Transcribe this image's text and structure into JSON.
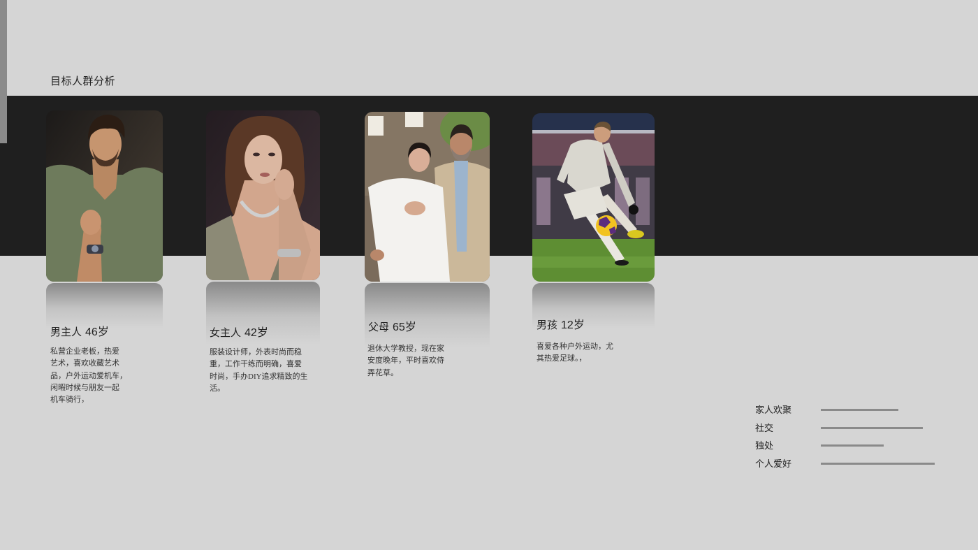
{
  "slide": {
    "title": "目标人群分析"
  },
  "colors": {
    "background": "#d5d5d5",
    "band": "#1f1f1f",
    "strip": "#8b8b8b",
    "bar": "#8a8a8a",
    "text": "#222222"
  },
  "people": [
    {
      "role": "男主人",
      "age": "46岁",
      "desc": [
        "私营企业老板，热爱",
        "艺术，喜欢收藏艺术",
        "品，户外运动爱机车，",
        "闲暇时候与朋友一起",
        "机车骑行，"
      ]
    },
    {
      "role": "女主人",
      "age": "42岁",
      "desc": [
        "服装设计师，外表时尚而稳",
        "重，工作干练而明确，喜爱",
        "时尚，手办DIY追求精致的生",
        "活。"
      ]
    },
    {
      "role": "父母",
      "age": "65岁",
      "desc": [
        "退休大学教授，现在家",
        "安度晚年，平时喜欢侍",
        "弄花草。"
      ]
    },
    {
      "role": "男孩",
      "age": "12岁",
      "desc": [
        "喜爱各种户外运动，尤",
        "其热爱足球。，"
      ]
    }
  ],
  "activities": [
    {
      "label": "家人欢聚",
      "level": 0.65
    },
    {
      "label": "社交",
      "level": 0.86
    },
    {
      "label": "独处",
      "level": 0.53
    },
    {
      "label": "个人爱好",
      "level": 0.96
    }
  ]
}
